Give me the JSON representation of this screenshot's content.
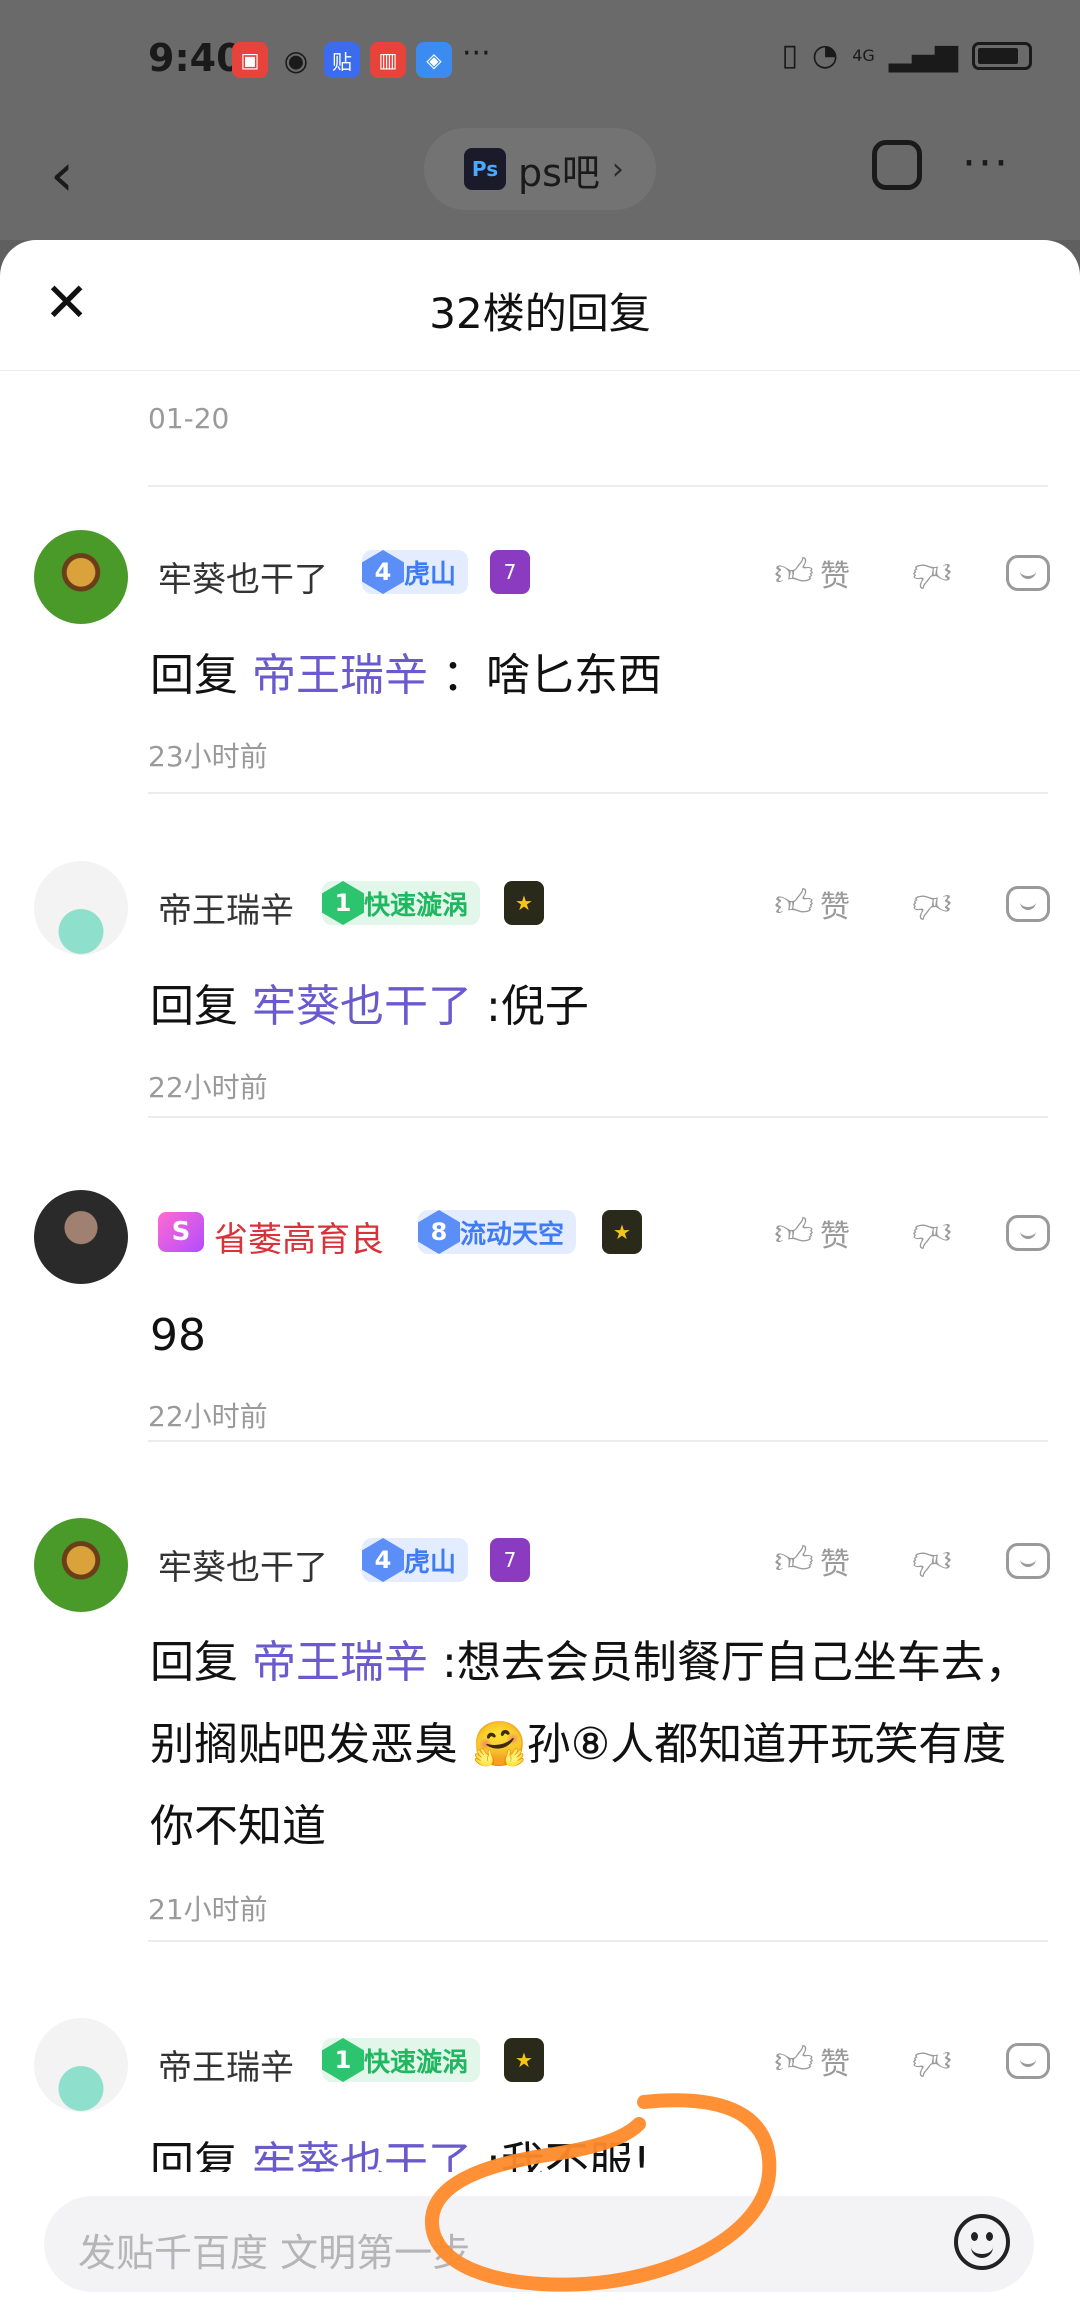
{
  "status": {
    "time": "9:40",
    "network": "4G"
  },
  "nav": {
    "forum_logo": "Ps",
    "forum_name": "ps吧"
  },
  "sheet": {
    "title": "32楼的回复",
    "prev_date": "01-20"
  },
  "like_label": "赞",
  "comments": [
    {
      "username": "牢葵也干了",
      "level": "4",
      "level_name": "虎山",
      "medal": "7",
      "reply_prefix": "回复",
      "mention": "帝王瑞辛",
      "text": "：啥匕东西",
      "time": "23小时前"
    },
    {
      "username": "帝王瑞辛",
      "level": "1",
      "level_name": "快速漩涡",
      "medal": "★",
      "reply_prefix": "回复",
      "mention": "牢葵也干了",
      "text": ":倪子",
      "time": "22小时前"
    },
    {
      "username": "省萎高育良",
      "vip": "S",
      "level": "8",
      "level_name": "流动天空",
      "medal": "★",
      "text": "98",
      "time": "22小时前"
    },
    {
      "username": "牢葵也干了",
      "level": "4",
      "level_name": "虎山",
      "medal": "7",
      "reply_prefix": "回复",
      "mention": "帝王瑞辛",
      "text": ":想去会员制餐厅自己坐车去，别搁贴吧发恶臭 🤗孙⑧人都知道开玩笑有度你不知道",
      "time": "21小时前"
    },
    {
      "username": "帝王瑞辛",
      "level": "1",
      "level_name": "快速漩涡",
      "medal": "★",
      "reply_prefix": "回复",
      "mention": "牢葵也干了",
      "text": ":我不服!"
    }
  ],
  "input": {
    "placeholder": "发贴千百度 文明第一步"
  },
  "colors": {
    "mention": "#6a5acd",
    "annotation": "#ff8a2a"
  }
}
